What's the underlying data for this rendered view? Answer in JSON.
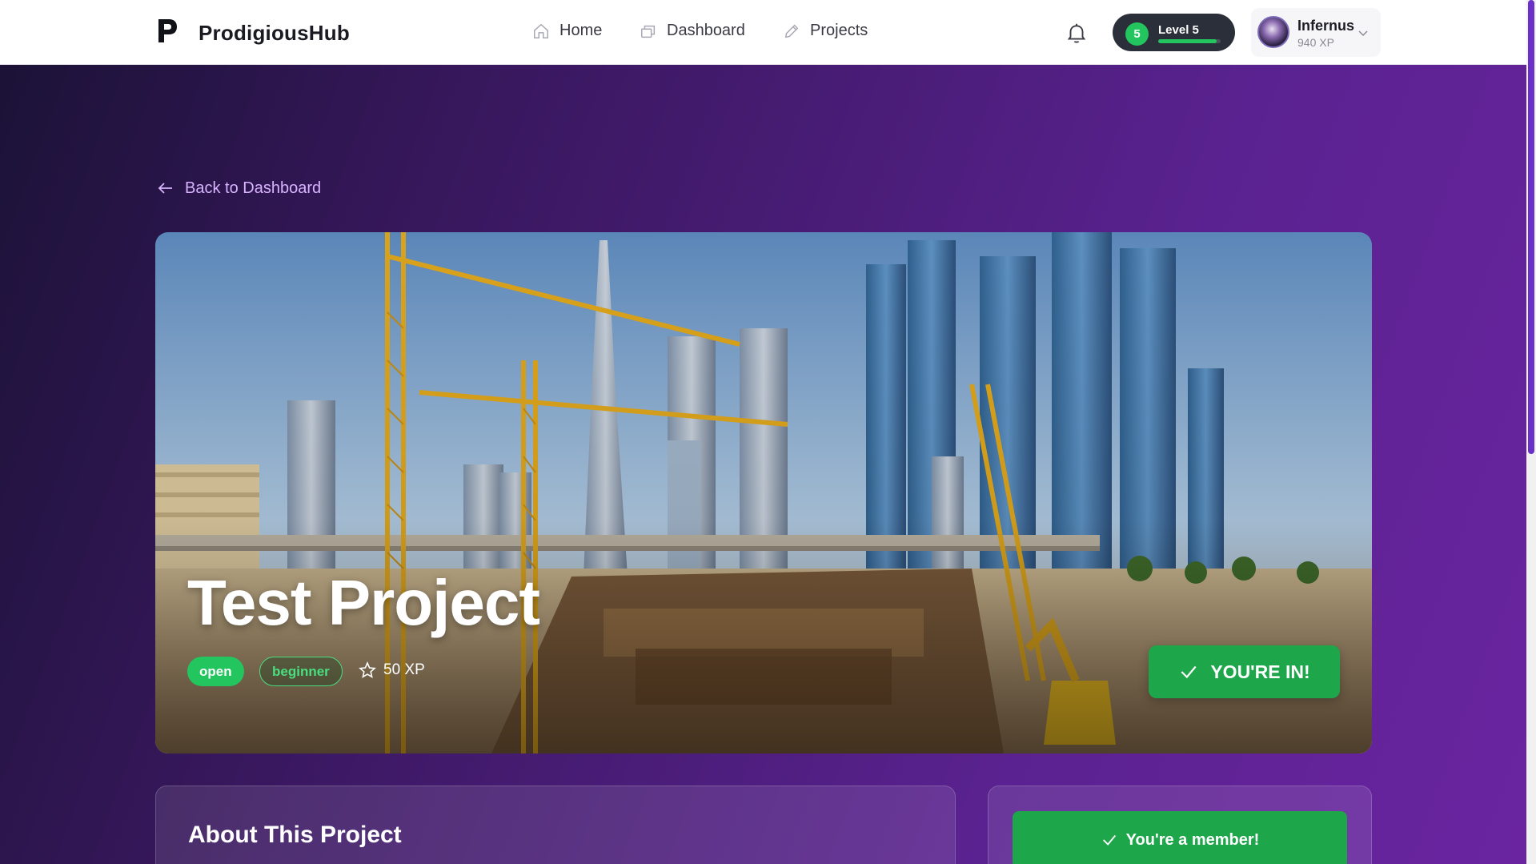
{
  "header": {
    "logo_letter": "P",
    "brand": "ProdigiousHub",
    "nav": [
      {
        "label": "Home",
        "icon": "home-icon"
      },
      {
        "label": "Dashboard",
        "icon": "dashboard-icon"
      },
      {
        "label": "Projects",
        "icon": "pencil-icon"
      }
    ],
    "level": {
      "number": "5",
      "label": "Level 5",
      "progress_percent": 94
    },
    "user": {
      "name": "Infernus",
      "xp": "940 XP"
    }
  },
  "back_link": "Back to Dashboard",
  "project": {
    "title": "Test Project",
    "status": "open",
    "difficulty": "beginner",
    "xp_reward": "50 XP",
    "join_status": "YOU'RE IN!"
  },
  "about": {
    "title": "About This Project"
  },
  "sidebar": {
    "member_status": "You're a member!"
  },
  "colors": {
    "accent_green": "#22c55e",
    "button_green": "#1ea64b",
    "link_purple": "#d8b4fe",
    "bg_purple": "#5a2290"
  }
}
